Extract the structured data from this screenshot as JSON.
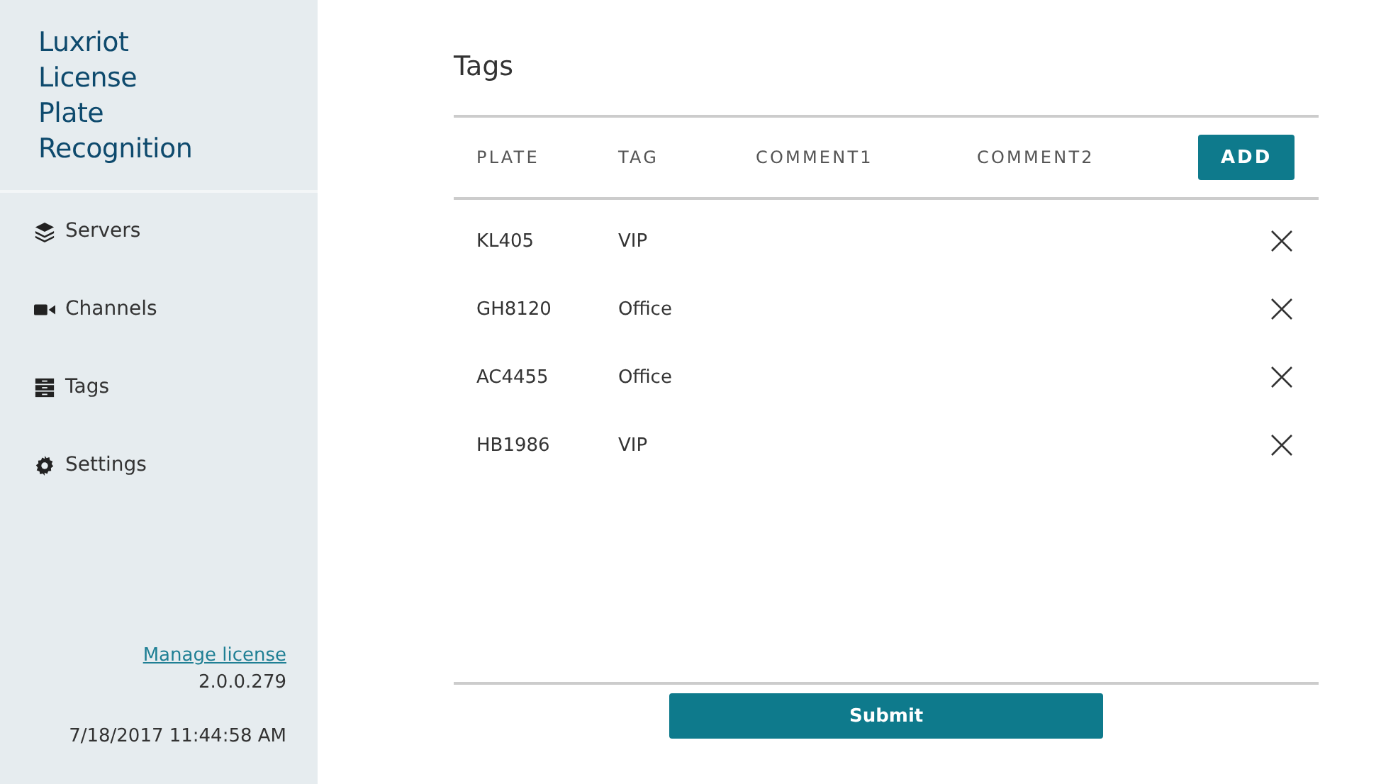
{
  "sidebar": {
    "title": [
      "Luxriot",
      "License",
      "Plate",
      "Recognition"
    ],
    "items": [
      {
        "label": "Servers",
        "kind": "servers"
      },
      {
        "label": "Channels",
        "kind": "channels"
      },
      {
        "label": "Tags",
        "kind": "tags"
      },
      {
        "label": "Settings",
        "kind": "settings"
      }
    ],
    "manage_link": "Manage license",
    "version": "2.0.0.279",
    "datetime": "7/18/2017 11:44:58 AM"
  },
  "page": {
    "title": "Tags"
  },
  "table": {
    "columns": [
      "PLATE",
      "TAG",
      "COMMENT1",
      "COMMENT2"
    ],
    "add_button": "ADD",
    "rows": [
      {
        "plate": "KL405",
        "tag": "VIP"
      },
      {
        "plate": "GH8120",
        "tag": "Office"
      },
      {
        "plate": "AC4455",
        "tag": "Office"
      },
      {
        "plate": "HB1986",
        "tag": "VIP"
      }
    ]
  },
  "submit_button": "Submit"
}
